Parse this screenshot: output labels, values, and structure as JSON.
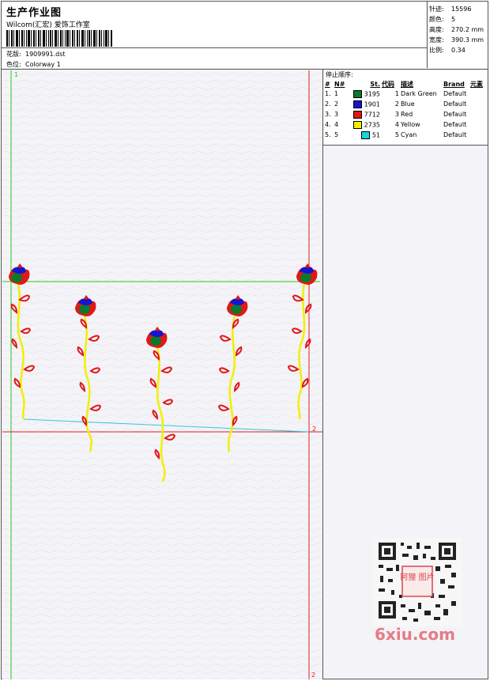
{
  "header": {
    "title": "生产作业图",
    "studio": "Wilcom(汇宏) 爱饰工作室",
    "design_label": "花版:",
    "design_value": "1909991.dst",
    "colorway_label": "色位:",
    "colorway_value": "Colorway 1"
  },
  "stats": [
    {
      "label": "针迹:",
      "value": "15596"
    },
    {
      "label": "颜色:",
      "value": "5"
    },
    {
      "label": "高度:",
      "value": "270.2 mm"
    },
    {
      "label": "宽度:",
      "value": "390.3 mm"
    },
    {
      "label": "比例:",
      "value": "0.34"
    }
  ],
  "stop_sequence": {
    "title": "停止顺序:",
    "columns": [
      "#",
      "N#",
      "St.",
      "代码",
      "描述",
      "Brand",
      "元素"
    ],
    "rows": [
      {
        "idx": "1.",
        "n": "1",
        "color": "#0a7a2a",
        "st": "3195",
        "code": "1",
        "desc": "Dark Green",
        "brand": "Default"
      },
      {
        "idx": "2.",
        "n": "2",
        "color": "#1414d2",
        "st": "1901",
        "code": "2",
        "desc": "Blue",
        "brand": "Default"
      },
      {
        "idx": "3.",
        "n": "3",
        "color": "#e01818",
        "st": "7712",
        "code": "3",
        "desc": "Red",
        "brand": "Default"
      },
      {
        "idx": "4.",
        "n": "4",
        "color": "#f0f000",
        "st": "2735",
        "code": "4",
        "desc": "Yellow",
        "brand": "Default"
      },
      {
        "idx": "5.",
        "n": "5",
        "color": "#19d7d7",
        "st": "51",
        "code": "5",
        "desc": "Cyan",
        "brand": "Default"
      }
    ]
  },
  "canvas": {
    "marker_start": "1",
    "marker_end_right": "2",
    "marker_end_bottom": "2",
    "guide_green": "#22cc22",
    "guide_red": "#e02020",
    "guide_cyan": "#30c8d8"
  },
  "watermark": {
    "text": "6xiu.com",
    "stamp": "阿狸 图片"
  }
}
